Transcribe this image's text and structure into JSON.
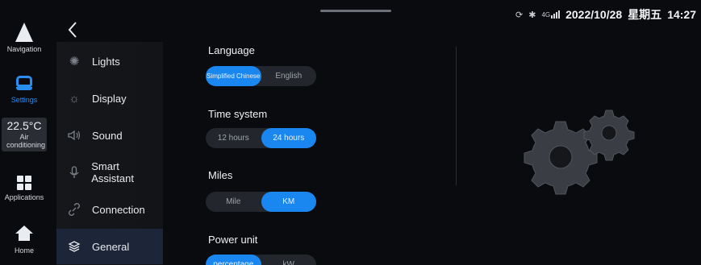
{
  "status": {
    "network": "4G",
    "date": "2022/10/28",
    "weekday": "星期五",
    "time": "14:27"
  },
  "rail": {
    "navigation": "Navigation",
    "settings": "Settings",
    "temperature": "22.5°C",
    "air_conditioning": "Air conditioning",
    "applications": "Applications",
    "home": "Home"
  },
  "menu": {
    "items": [
      {
        "label": "Lights",
        "icon": "lightbulb-icon"
      },
      {
        "label": "Display",
        "icon": "sun-icon"
      },
      {
        "label": "Sound",
        "icon": "speaker-icon"
      },
      {
        "label": "Smart Assistant",
        "icon": "microphone-icon"
      },
      {
        "label": "Connection",
        "icon": "link-icon"
      },
      {
        "label": "General",
        "icon": "layers-icon"
      }
    ],
    "active": "General"
  },
  "settings": {
    "language": {
      "title": "Language",
      "options": [
        "Simplified Chinese",
        "English"
      ],
      "selected": "Simplified Chinese"
    },
    "time_system": {
      "title": "Time system",
      "options": [
        "12 hours",
        "24 hours"
      ],
      "selected": "24 hours"
    },
    "miles": {
      "title": "Miles",
      "options": [
        "Mile",
        "KM"
      ],
      "selected": "KM"
    },
    "power_unit": {
      "title": "Power unit",
      "options": [
        "percentage",
        "kW"
      ],
      "selected": "percentage"
    }
  },
  "colors": {
    "accent": "#1a86f0",
    "background": "#0a0b0e"
  }
}
